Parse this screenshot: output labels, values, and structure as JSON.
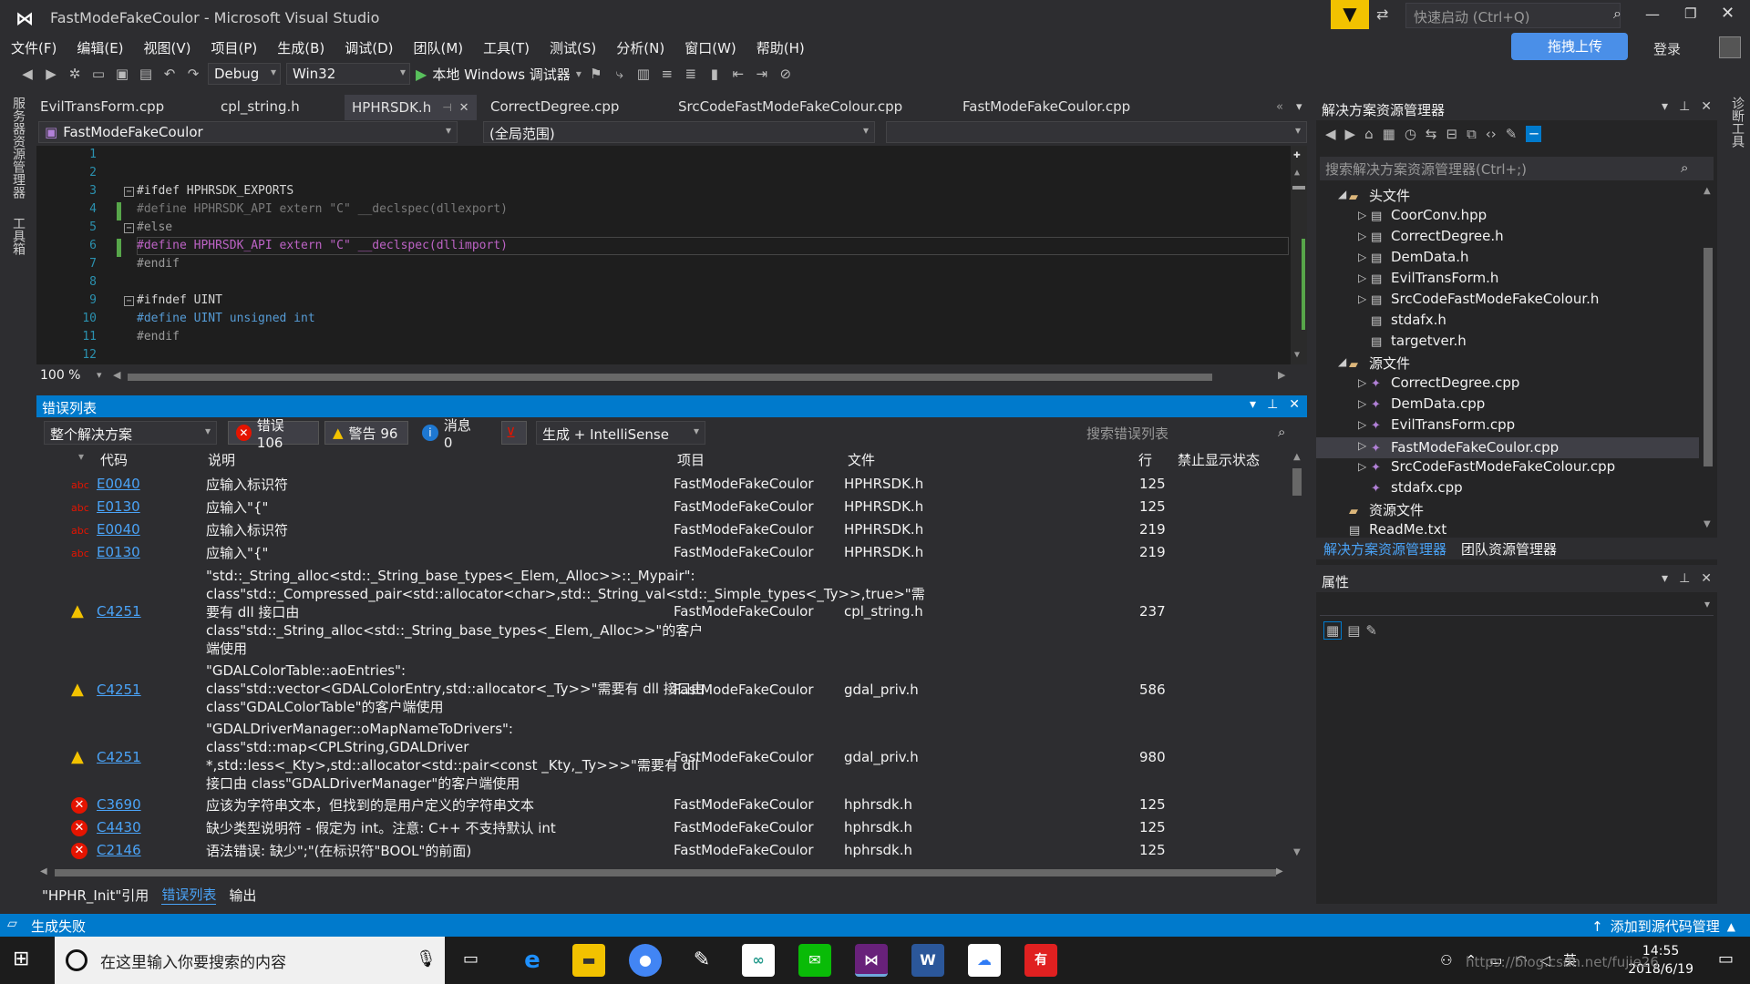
{
  "window": {
    "title": "FastModeFakeCoulor - Microsoft Visual Studio",
    "quick_launch_placeholder": "快速启动 (Ctrl+Q)",
    "upload_button": "拖拽上传",
    "login": "登录"
  },
  "menu": [
    "文件(F)",
    "编辑(E)",
    "视图(V)",
    "项目(P)",
    "生成(B)",
    "调试(D)",
    "团队(M)",
    "工具(T)",
    "测试(S)",
    "分析(N)",
    "窗口(W)",
    "帮助(H)"
  ],
  "toolbar": {
    "config": "Debug",
    "platform": "Win32",
    "run_label": "本地 Windows 调试器"
  },
  "left_edge_tabs": [
    "服务器资源管理器",
    "工具箱"
  ],
  "right_edge_tabs": [
    "诊断工具"
  ],
  "doc_tabs": [
    {
      "label": "EvilTransForm.cpp",
      "active": false
    },
    {
      "label": "cpl_string.h",
      "active": false
    },
    {
      "label": "HPHRSDK.h",
      "active": true
    },
    {
      "label": "CorrectDegree.cpp",
      "active": false
    },
    {
      "label": "SrcCodeFastModeFakeColour.cpp",
      "active": false
    },
    {
      "label": "FastModeFakeCoulor.cpp",
      "active": false
    }
  ],
  "nav": {
    "project": "FastModeFakeCoulor",
    "scope": "(全局范围)"
  },
  "editor": {
    "zoom": "100 %",
    "lines": [
      {
        "n": "1",
        "text": ""
      },
      {
        "n": "2",
        "text": ""
      },
      {
        "n": "3",
        "text": "#ifdef HPHRSDK_EXPORTS"
      },
      {
        "n": "4",
        "text": "#define HPHRSDK_API extern \"C\" __declspec(dllexport)"
      },
      {
        "n": "5",
        "text": "#else"
      },
      {
        "n": "6",
        "text": "#define HPHRSDK_API extern \"C\" __declspec(dllimport)"
      },
      {
        "n": "7",
        "text": "#endif"
      },
      {
        "n": "8",
        "text": ""
      },
      {
        "n": "9",
        "text": "#ifndef UINT"
      },
      {
        "n": "10",
        "text": "#define UINT unsigned int"
      },
      {
        "n": "11",
        "text": "#endif"
      },
      {
        "n": "12",
        "text": ""
      }
    ]
  },
  "error_list": {
    "title": "错误列表",
    "scope": "整个解决方案",
    "errors_btn": "错误 106",
    "warnings_btn": "警告 96",
    "messages_btn": "消息 0",
    "build_filter": "生成 + IntelliSense",
    "search_placeholder": "搜索错误列表",
    "columns": [
      "代码",
      "说明",
      "项目",
      "文件",
      "行",
      "禁止显示状态"
    ],
    "rows": [
      {
        "icon": "abc",
        "code": "E0040",
        "desc": "应输入标识符",
        "project": "FastModeFakeCoulor",
        "file": "HPHRSDK.h",
        "line": "125"
      },
      {
        "icon": "abc",
        "code": "E0130",
        "desc": "应输入\"{\"",
        "project": "FastModeFakeCoulor",
        "file": "HPHRSDK.h",
        "line": "125"
      },
      {
        "icon": "abc",
        "code": "E0040",
        "desc": "应输入标识符",
        "project": "FastModeFakeCoulor",
        "file": "HPHRSDK.h",
        "line": "219"
      },
      {
        "icon": "abc",
        "code": "E0130",
        "desc": "应输入\"{\"",
        "project": "FastModeFakeCoulor",
        "file": "HPHRSDK.h",
        "line": "219"
      },
      {
        "icon": "warn",
        "code": "C4251",
        "desc": "\"std::_String_alloc<std::_String_base_types<_Elem,_Alloc>>::_Mypair\": class\"std::_Compressed_pair<std::allocator<char>,std::_String_val<std::_Simple_types<_Ty>>,true>\"需要有 dll 接口由 class\"std::_String_alloc<std::_String_base_types<_Elem,_Alloc>>\"的客户端使用",
        "project": "FastModeFakeCoulor",
        "file": "cpl_string.h",
        "line": "237"
      },
      {
        "icon": "warn",
        "code": "C4251",
        "desc": "\"GDALColorTable::aoEntries\": class\"std::vector<GDALColorEntry,std::allocator<_Ty>>\"需要有 dll 接口由 class\"GDALColorTable\"的客户端使用",
        "project": "FastModeFakeCoulor",
        "file": "gdal_priv.h",
        "line": "586"
      },
      {
        "icon": "warn",
        "code": "C4251",
        "desc": "\"GDALDriverManager::oMapNameToDrivers\": class\"std::map<CPLString,GDALDriver *,std::less<_Kty>,std::allocator<std::pair<const _Kty,_Ty>>>\"需要有 dll 接口由 class\"GDALDriverManager\"的客户端使用",
        "project": "FastModeFakeCoulor",
        "file": "gdal_priv.h",
        "line": "980"
      },
      {
        "icon": "err",
        "code": "C3690",
        "desc": "应该为字符串文本，但找到的是用户定义的字符串文本",
        "project": "FastModeFakeCoulor",
        "file": "hphrsdk.h",
        "line": "125"
      },
      {
        "icon": "err",
        "code": "C4430",
        "desc": "缺少类型说明符 - 假定为 int。注意: C++ 不支持默认 int",
        "project": "FastModeFakeCoulor",
        "file": "hphrsdk.h",
        "line": "125"
      },
      {
        "icon": "err",
        "code": "C2146",
        "desc": "语法错误: 缺少\";\"(在标识符\"BOOL\"的前面)",
        "project": "FastModeFakeCoulor",
        "file": "hphrsdk.h",
        "line": "125"
      }
    ]
  },
  "bottom_tabs": [
    {
      "label": "\"HPHR_Init\"引用",
      "active": false
    },
    {
      "label": "错误列表",
      "active": true
    },
    {
      "label": "输出",
      "active": false
    }
  ],
  "solution_explorer": {
    "title": "解决方案资源管理器",
    "search_placeholder": "搜索解决方案资源管理器(Ctrl+;)",
    "tree": [
      {
        "label": "头文件",
        "kind": "folder",
        "expander": "open",
        "indent": 0
      },
      {
        "label": "CoorConv.hpp",
        "kind": "h",
        "expander": "closed",
        "indent": 1
      },
      {
        "label": "CorrectDegree.h",
        "kind": "h",
        "expander": "closed",
        "indent": 1
      },
      {
        "label": "DemData.h",
        "kind": "h",
        "expander": "closed",
        "indent": 1
      },
      {
        "label": "EvilTransForm.h",
        "kind": "h",
        "expander": "closed",
        "indent": 1
      },
      {
        "label": "SrcCodeFastModeFakeColour.h",
        "kind": "h",
        "expander": "closed",
        "indent": 1
      },
      {
        "label": "stdafx.h",
        "kind": "h",
        "expander": "none",
        "indent": 1
      },
      {
        "label": "targetver.h",
        "kind": "h",
        "expander": "none",
        "indent": 1
      },
      {
        "label": "源文件",
        "kind": "folder",
        "expander": "open",
        "indent": 0
      },
      {
        "label": "CorrectDegree.cpp",
        "kind": "cpp",
        "expander": "closed",
        "indent": 1
      },
      {
        "label": "DemData.cpp",
        "kind": "cpp",
        "expander": "closed",
        "indent": 1
      },
      {
        "label": "EvilTransForm.cpp",
        "kind": "cpp",
        "expander": "closed",
        "indent": 1
      },
      {
        "label": "FastModeFakeCoulor.cpp",
        "kind": "cpp",
        "expander": "closed",
        "indent": 1,
        "selected": true
      },
      {
        "label": "SrcCodeFastModeFakeColour.cpp",
        "kind": "cpp",
        "expander": "closed",
        "indent": 1
      },
      {
        "label": "stdafx.cpp",
        "kind": "cpp",
        "expander": "none",
        "indent": 1
      },
      {
        "label": "资源文件",
        "kind": "folder",
        "expander": "none",
        "indent": 0
      },
      {
        "label": "ReadMe.txt",
        "kind": "txt",
        "expander": "none",
        "indent": 0
      }
    ],
    "tabs": [
      {
        "label": "解决方案资源管理器",
        "active": true
      },
      {
        "label": "团队资源管理器",
        "active": false
      }
    ]
  },
  "properties": {
    "title": "属性"
  },
  "status": {
    "text": "生成失败",
    "source_control": "添加到源代码管理"
  },
  "taskbar": {
    "search_placeholder": "在这里输入你要搜索的内容",
    "apps": [
      "Edge",
      "文件资源管理器",
      "Chrome",
      "Paint",
      "百度网盘",
      "微信",
      "Visual Studio",
      "Word",
      "百度网盘",
      "有道"
    ],
    "ime": "英",
    "time": "14:55",
    "date": "2018/6/19"
  },
  "watermark": "https://blog.csdn.net/fujie26",
  "colors": {
    "accent": "#007acc",
    "error": "#e51400",
    "warning": "#f2c200",
    "link": "#4aa3f7"
  }
}
